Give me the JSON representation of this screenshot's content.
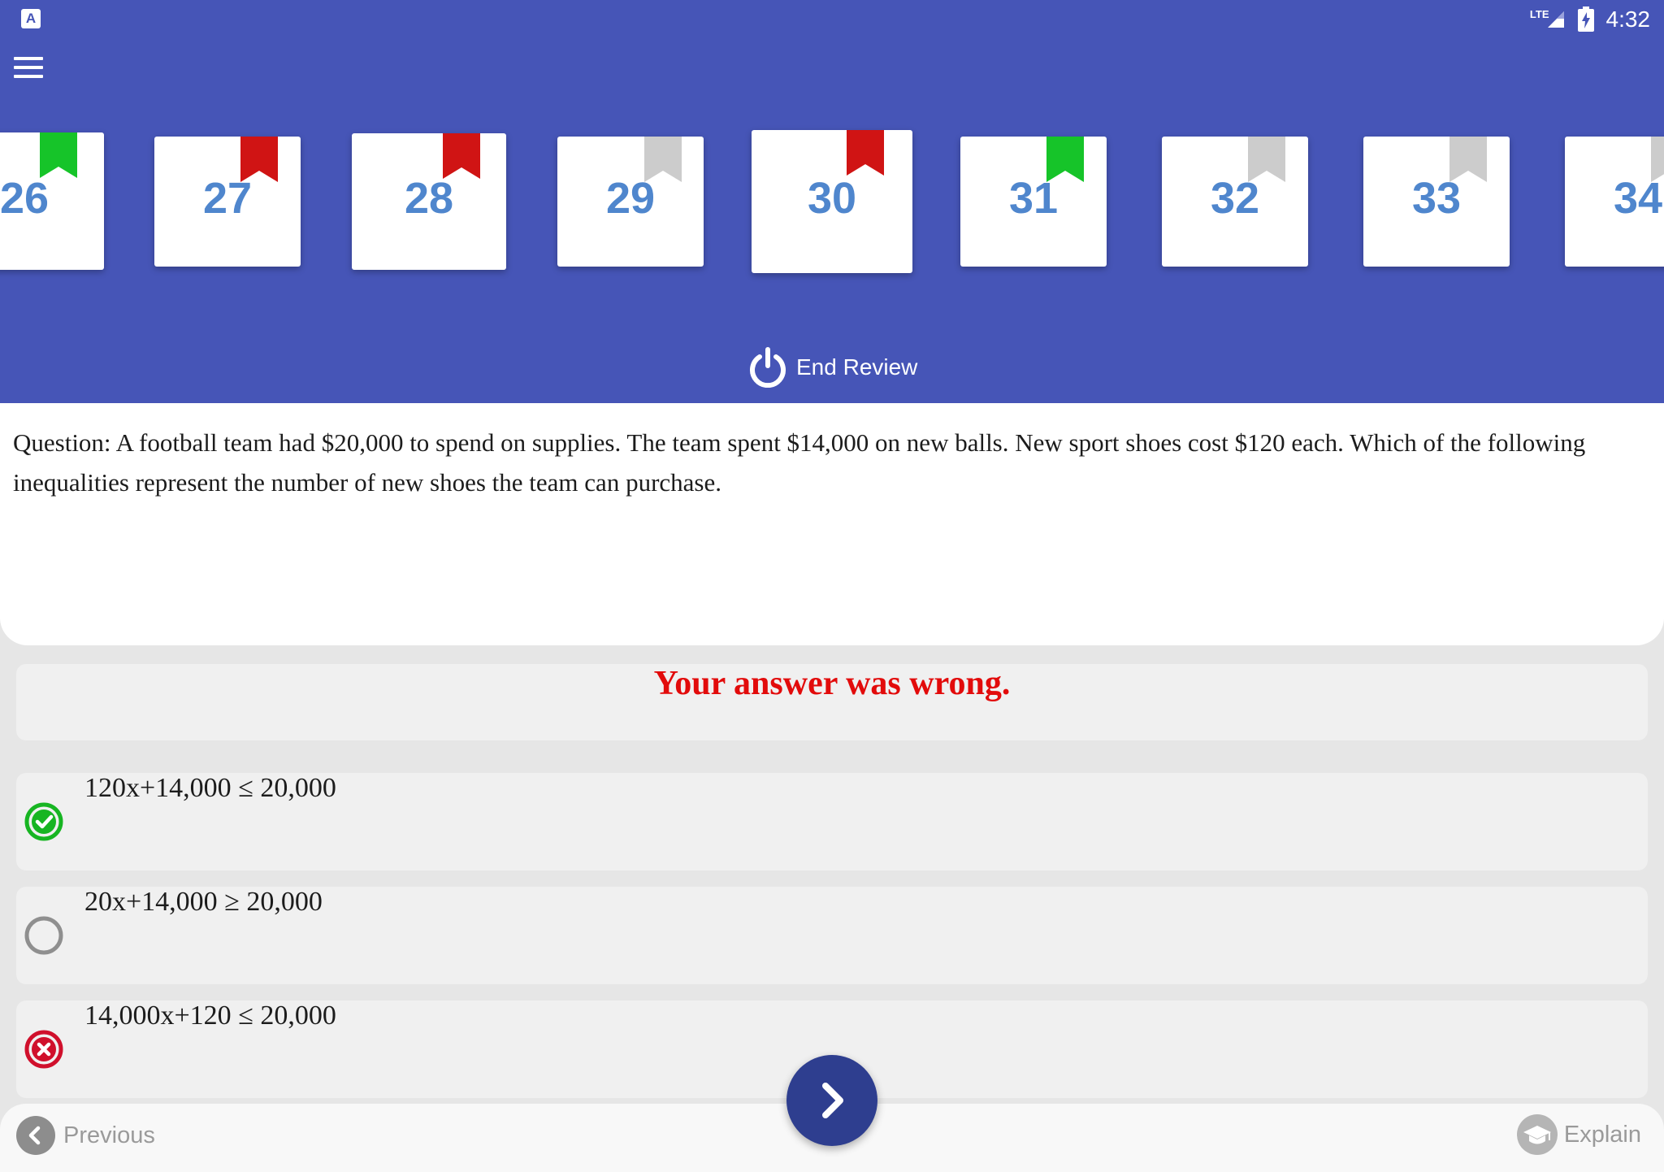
{
  "status_bar": {
    "app_icon": "A",
    "network": "LTE",
    "time": "4:32",
    "icons": [
      "app-notification-icon",
      "signal-icon",
      "battery-charging-icon"
    ]
  },
  "header": {
    "menu_icon": "hamburger-menu-icon",
    "question_cards": [
      {
        "number": "26",
        "flag": "green"
      },
      {
        "number": "27",
        "flag": "red"
      },
      {
        "number": "28",
        "flag": "red"
      },
      {
        "number": "29",
        "flag": "gray"
      },
      {
        "number": "30",
        "flag": "red",
        "selected": true
      },
      {
        "number": "31",
        "flag": "green"
      },
      {
        "number": "32",
        "flag": "gray"
      },
      {
        "number": "33",
        "flag": "gray"
      },
      {
        "number": "34",
        "flag": "gray"
      }
    ],
    "end_review_label": "End Review",
    "end_review_icon": "power-icon"
  },
  "question": {
    "text": "Question: A football team had $20,000 to spend on supplies. The team spent $14,000 on new balls. New sport shoes cost $120 each. Which of the following inequalities represent the number of new shoes the team can purchase."
  },
  "result": {
    "text": "Your answer was wrong."
  },
  "answers": [
    {
      "text": "120x+14,000 ≤ 20,000",
      "state": "correct",
      "icon": "check-circle-icon"
    },
    {
      "text": "20x+14,000 ≥ 20,000",
      "state": "unselected",
      "icon": "radio-empty-icon"
    },
    {
      "text": "14,000x+120 ≤ 20,000",
      "state": "wrong",
      "icon": "x-circle-icon"
    }
  ],
  "footer": {
    "previous_label": "Previous",
    "explain_label": "Explain",
    "next_icon": "chevron-right-icon",
    "previous_icon": "chevron-left-icon",
    "explain_icon": "graduation-cap-icon"
  },
  "colors": {
    "header": "#4655b7",
    "card_number": "#4f86cd",
    "flag_green": "#16c429",
    "flag_red": "#d01414",
    "flag_gray": "#cccccc",
    "wrong_text": "#e20b0b",
    "correct_icon": "#17b522",
    "wrong_icon": "#d0102c",
    "next_button": "#2e3e8f"
  }
}
